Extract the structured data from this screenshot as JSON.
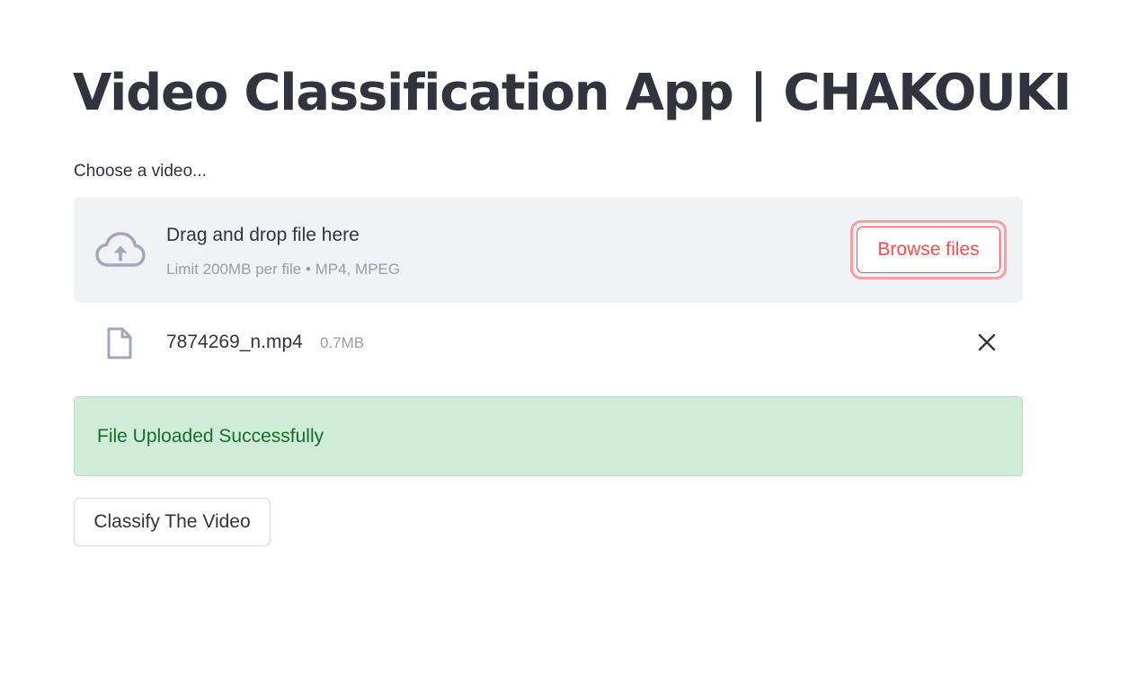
{
  "header": {
    "title": "Video Classification App | CHAKOUKI"
  },
  "uploader": {
    "label": "Choose a video...",
    "dropzone_title": "Drag and drop file here",
    "dropzone_limit": "Limit 200MB per file • MP4, MPEG",
    "browse_label": "Browse files",
    "upload_icon": "cloud-upload-icon"
  },
  "file": {
    "name": "7874269_n.mp4",
    "size": "0.7MB",
    "icon": "file-icon",
    "remove_icon": "close-icon"
  },
  "alert": {
    "message": "File Uploaded Successfully"
  },
  "actions": {
    "classify_label": "Classify The Video"
  },
  "colors": {
    "accent": "#ff4b4b",
    "text": "#31333f",
    "muted": "#9a9ca5",
    "dropzone_bg": "#f0f2f6",
    "success_bg": "#cfecd7",
    "success_text": "#176c2f",
    "icon": "#a3a8b8"
  }
}
